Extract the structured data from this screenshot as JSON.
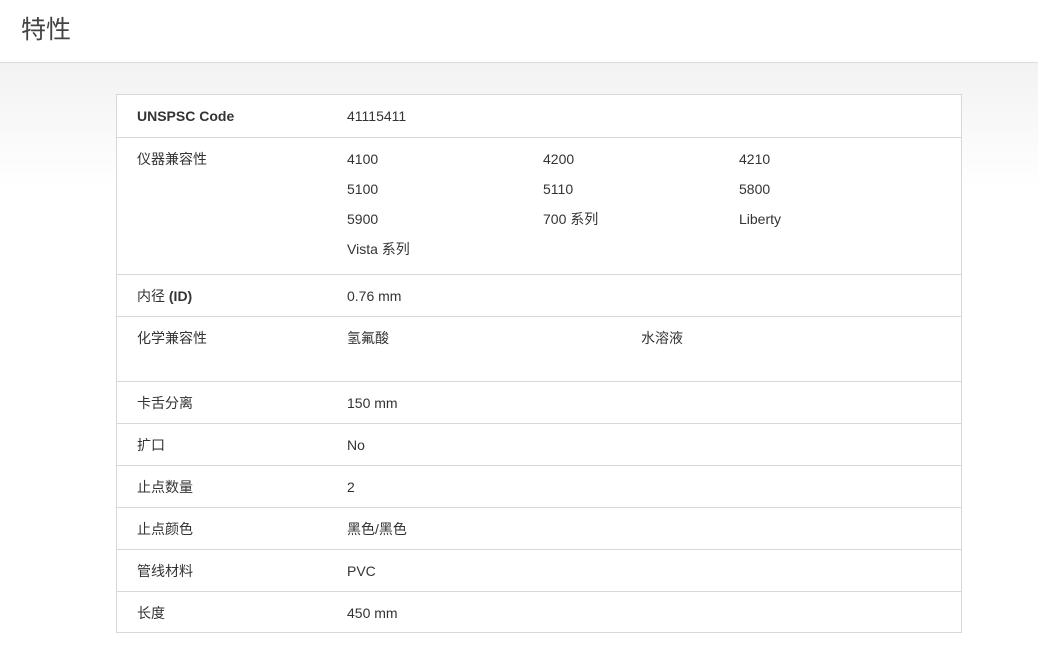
{
  "header": {
    "title": "特性"
  },
  "specs": {
    "unspsc": {
      "label": "UNSPSC Code",
      "value": "41115411"
    },
    "instrument_compat": {
      "label": "仪器兼容性",
      "values": [
        "4100",
        "4200",
        "4210",
        "5100",
        "5110",
        "5800",
        "5900",
        "700 系列",
        "Liberty",
        "Vista 系列"
      ]
    },
    "inner_diameter": {
      "label_prefix": "内径 ",
      "label_suffix": "(ID)",
      "value": "0.76 mm"
    },
    "chem_compat": {
      "label": "化学兼容性",
      "values": [
        "氢氟酸",
        "水溶液"
      ]
    },
    "tongue_separation": {
      "label": "卡舌分离",
      "value": "150 mm"
    },
    "flared": {
      "label": "扩口",
      "value": "No"
    },
    "stop_count": {
      "label": "止点数量",
      "value": "2"
    },
    "stop_color": {
      "label": "止点颜色",
      "value": "黑色/黑色"
    },
    "tubing_material": {
      "label": "管线材料",
      "value": "PVC"
    },
    "length": {
      "label": "长度",
      "value": "450 mm"
    }
  },
  "colors": {
    "border": "#d8d8d8",
    "text": "#333333",
    "background_gray": "#ececec"
  }
}
